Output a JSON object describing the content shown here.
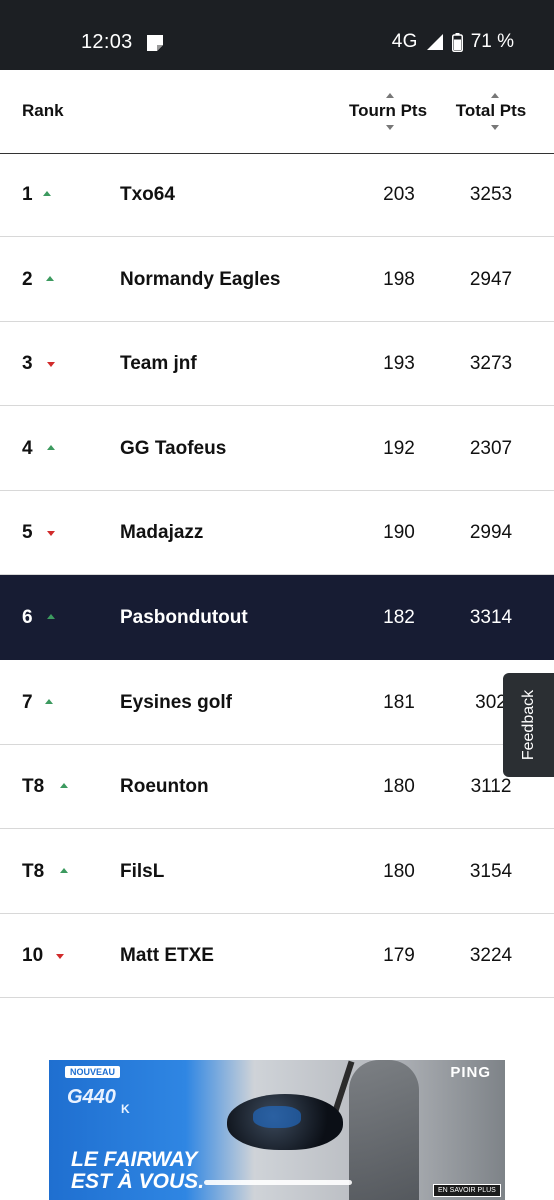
{
  "status_bar": {
    "time": "12:03",
    "network": "4G",
    "battery": "71 %"
  },
  "table_header": {
    "rank": "Rank",
    "tourn_pts": "Tourn Pts",
    "total_pts": "Total Pts"
  },
  "rows": [
    {
      "rank": "1",
      "trend": "up",
      "team": "Txo64",
      "tourn": "203",
      "total": "3253"
    },
    {
      "rank": "2",
      "trend": "up",
      "team": "Normandy Eagles",
      "tourn": "198",
      "total": "2947"
    },
    {
      "rank": "3",
      "trend": "down",
      "team": "Team jnf",
      "tourn": "193",
      "total": "3273"
    },
    {
      "rank": "4",
      "trend": "up",
      "team": "GG Taofeus",
      "tourn": "192",
      "total": "2307"
    },
    {
      "rank": "5",
      "trend": "down",
      "team": "Madajazz",
      "tourn": "190",
      "total": "2994"
    },
    {
      "rank": "6",
      "trend": "up",
      "team": "Pasbondutout",
      "tourn": "182",
      "total": "3314",
      "highlight": true
    },
    {
      "rank": "7",
      "trend": "up",
      "team": "Eysines golf",
      "tourn": "181",
      "total": "302"
    },
    {
      "rank": "T8",
      "trend": "up",
      "team": "Roeunton",
      "tourn": "180",
      "total": "3112"
    },
    {
      "rank": "T8",
      "trend": "up",
      "team": "FilsL",
      "tourn": "180",
      "total": "3154"
    },
    {
      "rank": "10",
      "trend": "down",
      "team": "Matt ETXE",
      "tourn": "179",
      "total": "3224"
    }
  ],
  "feedback": {
    "label": "Feedback"
  },
  "ad": {
    "badge": "NOUVEAU",
    "model": "G440",
    "model_variant": "K",
    "headline_line1": "LE FAIRWAY",
    "headline_line2": "EST À VOUS.",
    "brand": "PING",
    "cta": "EN SAVOIR PLUS"
  },
  "colors": {
    "status_bar_bg": "#1c1f23",
    "highlight_row_bg": "#171c33",
    "trend_up": "#3c9a5f",
    "trend_down": "#d12b2b",
    "ad_blue": "#1f6fd0"
  }
}
